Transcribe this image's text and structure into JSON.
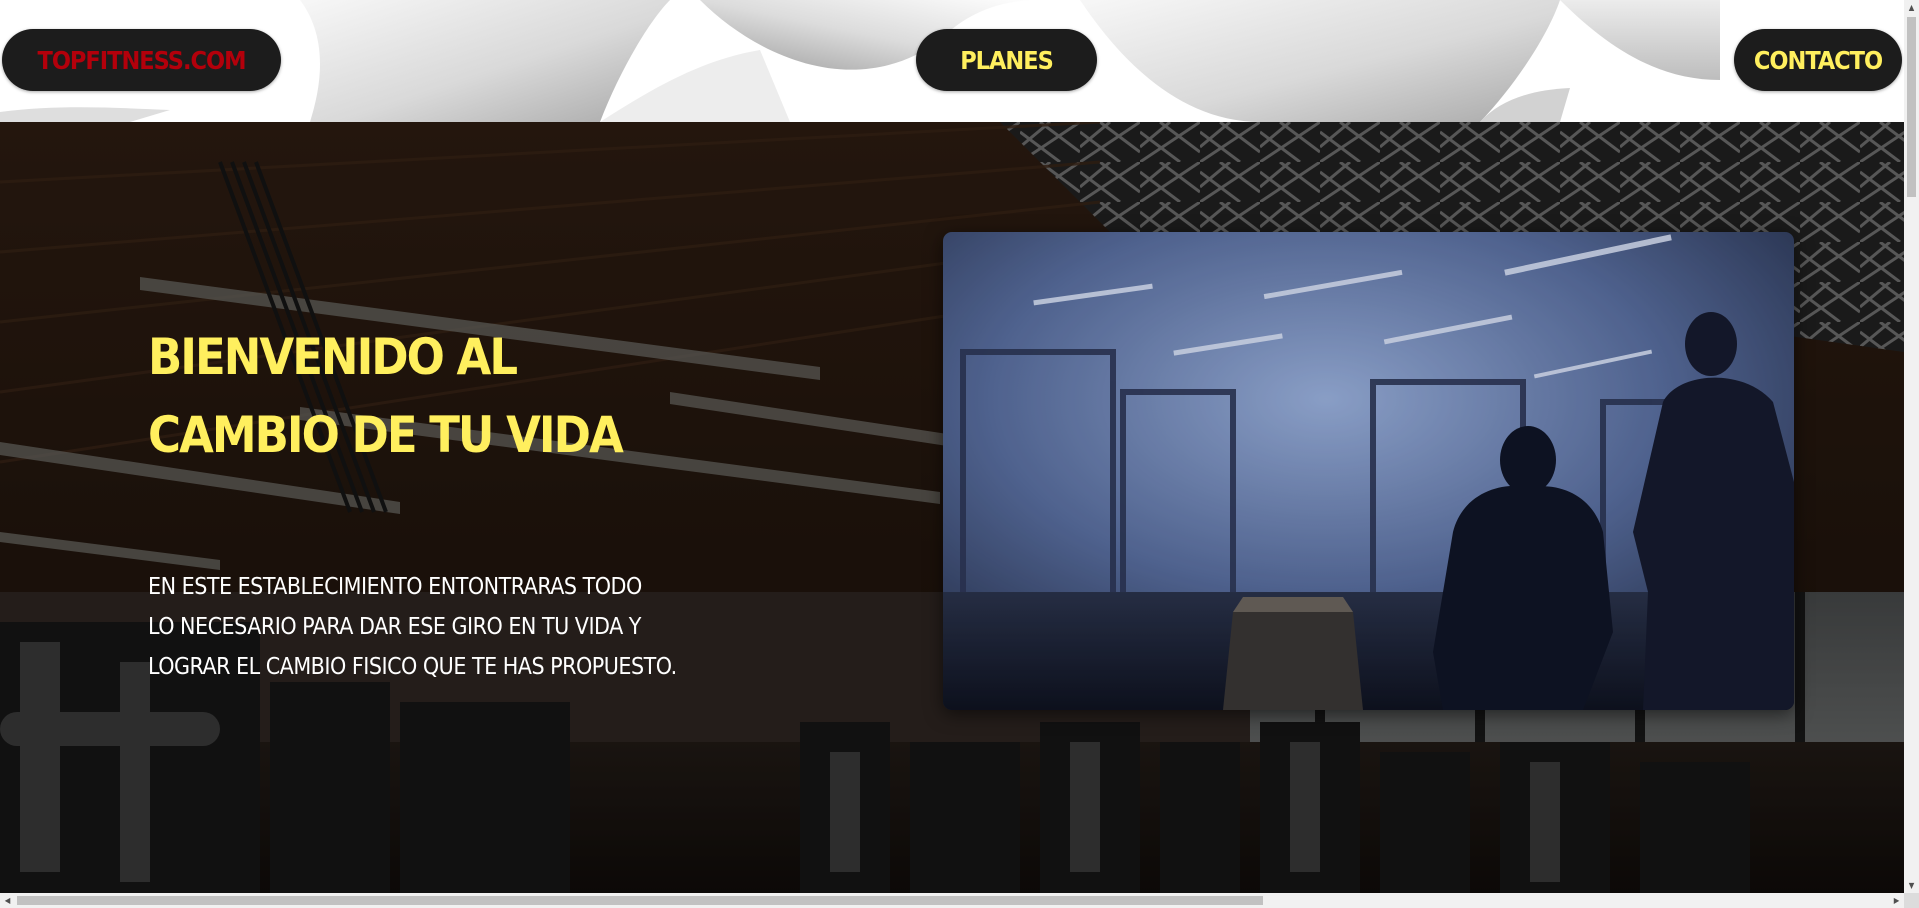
{
  "header": {
    "logo_label": "TOPFITNESS.COM",
    "nav": {
      "planes_label": "PLANES",
      "contacto_label": "CONTACTO"
    }
  },
  "hero": {
    "title_lines": [
      "BIENVENIDO AL",
      "CAMBIO DE TU VIDA"
    ],
    "text_lines": [
      "EN ESTE ESTABLECIMIENTO ENTONTRARAS TODO",
      "LO NECESARIO PARA DAR ESE GIRO EN TU VIDA Y",
      "LOGRAR EL CAMBIO FISICO QUE TE HAS PROPUESTO."
    ],
    "background_image": "gym-interior-photo",
    "media_image": "gym-training-video-still"
  },
  "colors": {
    "pill_background": "#1c1c1c",
    "logo_red": "#b3000b",
    "accent_yellow": "#ffef5e",
    "body_text": "#ffffff"
  },
  "icons": {
    "scroll_up": "▲",
    "scroll_down": "▼",
    "scroll_left": "◀",
    "scroll_right": "▶"
  }
}
